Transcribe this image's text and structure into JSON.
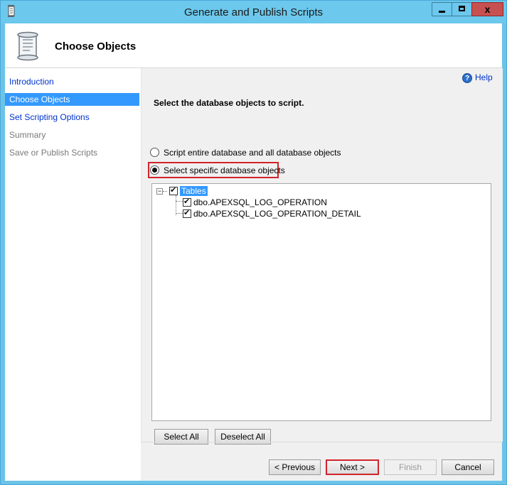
{
  "window": {
    "title": "Generate and Publish Scripts",
    "close_label": "x"
  },
  "header": {
    "title": "Choose Objects",
    "icon": "script-scroll-icon"
  },
  "nav": {
    "items": [
      {
        "label": "Introduction",
        "state": "link"
      },
      {
        "label": "Choose Objects",
        "state": "selected"
      },
      {
        "label": "Set Scripting Options",
        "state": "link"
      },
      {
        "label": "Summary",
        "state": "disabled"
      },
      {
        "label": "Save or Publish Scripts",
        "state": "disabled"
      }
    ]
  },
  "content": {
    "help_label": "Help",
    "instruction": "Select the database objects to script.",
    "radio_entire": "Script entire database and all database objects",
    "radio_specific": "Select specific database objects",
    "selected_option": "radio_specific",
    "tree": {
      "root": {
        "label": "Tables",
        "checked": true,
        "expanded": true
      },
      "children": [
        {
          "label": "dbo.APEXSQL_LOG_OPERATION",
          "checked": true
        },
        {
          "label": "dbo.APEXSQL_LOG_OPERATION_DETAIL",
          "checked": true
        }
      ]
    },
    "select_all": "Select All",
    "deselect_all": "Deselect All"
  },
  "footer": {
    "previous": "< Previous",
    "next": "Next >",
    "finish": "Finish",
    "cancel": "Cancel"
  },
  "colors": {
    "titlebar": "#6cc8ec",
    "selection": "#3399ff",
    "highlight_border": "#d1232a",
    "link": "#0033cc"
  }
}
